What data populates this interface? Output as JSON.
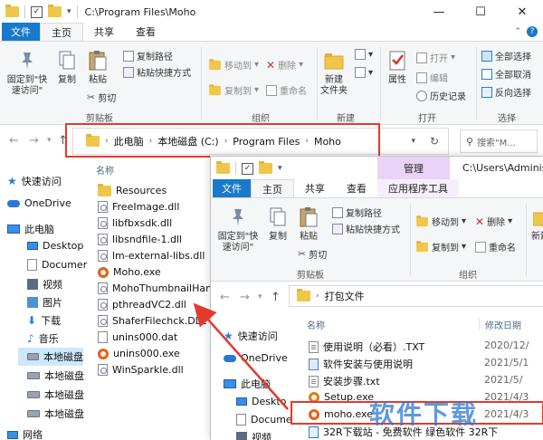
{
  "back_window": {
    "title": "C:\\Program Files\\Moho",
    "tabs": [
      {
        "label": "文件"
      },
      {
        "label": "主页"
      },
      {
        "label": "共享"
      },
      {
        "label": "查看"
      }
    ],
    "ribbon": {
      "clipboard": {
        "pin_label": "固定到\"快\n速访问\"",
        "copy_label": "复制",
        "paste_label": "粘贴",
        "copy_path": "复制路径",
        "paste_shortcut": "粘贴快捷方式",
        "cut": "剪切",
        "group_label": "剪贴板"
      },
      "organize": {
        "move_to": "移动到",
        "copy_to": "复制到",
        "delete": "删除",
        "rename": "重命名",
        "group_label": "组织"
      },
      "new": {
        "new_folder": "新建\n文件夹",
        "group_label": "新建"
      },
      "open": {
        "properties": "属性",
        "open": "打开",
        "edit": "编辑",
        "history": "历史记录",
        "group_label": "打开"
      },
      "select": {
        "select_all": "全部选择",
        "select_none": "全部取消",
        "invert": "反向选择",
        "group_label": "选择"
      }
    },
    "address": {
      "crumbs": [
        "此电脑",
        "本地磁盘 (C:)",
        "Program Files",
        "Moho"
      ],
      "search_placeholder": "搜索\"M..."
    },
    "nav": [
      {
        "label": "快速访问",
        "icon": "star-icon"
      },
      {
        "label": "OneDrive",
        "icon": "cloud-icon"
      },
      {
        "label": "此电脑",
        "icon": "computer-icon"
      },
      {
        "label": "Desktop",
        "icon": "folder-icon"
      },
      {
        "label": "Documer",
        "icon": "folder-icon"
      },
      {
        "label": "视频",
        "icon": "folder-icon"
      },
      {
        "label": "图片",
        "icon": "folder-icon"
      },
      {
        "label": "下载",
        "icon": "download-icon"
      },
      {
        "label": "音乐",
        "icon": "music-icon"
      },
      {
        "label": "本地磁盘",
        "icon": "drive-icon"
      },
      {
        "label": "本地磁盘",
        "icon": "drive-icon"
      },
      {
        "label": "本地磁盘",
        "icon": "drive-icon"
      },
      {
        "label": "本地磁盘",
        "icon": "drive-icon"
      },
      {
        "label": "网络",
        "icon": "network-icon"
      }
    ],
    "column_name": "名称",
    "files": [
      {
        "name": "Resources",
        "icon": "folder-icon"
      },
      {
        "name": "FreeImage.dll",
        "icon": "dll-icon"
      },
      {
        "name": "libfbxsdk.dll",
        "icon": "dll-icon"
      },
      {
        "name": "libsndfile-1.dll",
        "icon": "dll-icon"
      },
      {
        "name": "lm-external-libs.dll",
        "icon": "dll-icon"
      },
      {
        "name": "Moho.exe",
        "icon": "moho-icon"
      },
      {
        "name": "MohoThumbnailHandl",
        "icon": "dll-icon"
      },
      {
        "name": "pthreadVC2.dll",
        "icon": "dll-icon"
      },
      {
        "name": "ShaferFilechck.DLL",
        "icon": "dll-icon"
      },
      {
        "name": "unins000.dat",
        "icon": "dat-icon"
      },
      {
        "name": "unins000.exe",
        "icon": "moho-icon"
      },
      {
        "name": "WinSparkle.dll",
        "icon": "dll-icon"
      }
    ]
  },
  "front_window": {
    "title": "C:\\Users\\Administ",
    "context_tab": "管理",
    "context_sub": "应用程序工具",
    "tabs": [
      {
        "label": "文件"
      },
      {
        "label": "主页"
      },
      {
        "label": "共享"
      },
      {
        "label": "查看"
      }
    ],
    "ribbon": {
      "pin_label": "固定到\"快\n速访问\"",
      "copy_label": "复制",
      "paste_label": "粘贴",
      "copy_path": "复制路径",
      "paste_shortcut": "粘贴快捷方式",
      "cut": "剪切",
      "clipboard_group": "剪贴板",
      "move_to": "移动到",
      "copy_to": "复制到",
      "delete": "删除",
      "rename": "重命名",
      "organize_group": "组织",
      "new_label": "新建"
    },
    "address": {
      "crumbs": [
        "打包文件"
      ]
    },
    "nav": [
      {
        "label": "快速访问",
        "icon": "star-icon"
      },
      {
        "label": "OneDrive",
        "icon": "cloud-icon"
      },
      {
        "label": "此电脑",
        "icon": "computer-icon"
      },
      {
        "label": "Deskto",
        "icon": "folder-icon"
      },
      {
        "label": "Docume",
        "icon": "folder-icon"
      },
      {
        "label": "视频",
        "icon": "folder-icon"
      }
    ],
    "columns": {
      "name": "名称",
      "date": "修改日期"
    },
    "files": [
      {
        "name": "使用说明（必看）.TXT",
        "date": "2020/12/",
        "icon": "txt-icon"
      },
      {
        "name": "软件安装与使用说明",
        "date": "2021/5/1",
        "icon": "doc-icon"
      },
      {
        "name": "安装步骤.txt",
        "date": "2021/5/",
        "icon": "txt-icon"
      },
      {
        "name": "Setup.exe",
        "date": "2021/4/3",
        "icon": "setup-icon"
      },
      {
        "name": "moho.exe",
        "date": "2021/4/3",
        "icon": "moho-icon"
      },
      {
        "name": "32R下载站 - 免费软件 绿色软件 32R下",
        "date": "",
        "icon": "link-icon"
      }
    ]
  },
  "watermark": "软件下载"
}
